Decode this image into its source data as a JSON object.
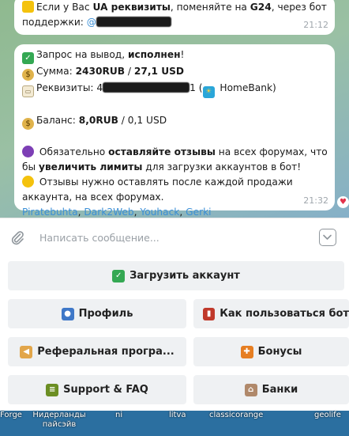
{
  "chat": {
    "message1": {
      "line1_pre": "Если у Вас ",
      "line1_bold": "UA реквизиты",
      "line1_mid": ", поменяйте на ",
      "line1_bold2": "G24",
      "line1_post": ", через бот",
      "line2_pre": "поддержки: ",
      "mention_prefix": "@",
      "time": "21:12"
    },
    "message2": {
      "l1_pre": "Запрос на вывод, ",
      "l1_bold": "исполнен",
      "l1_post": "!",
      "l2_pre": "Сумма: ",
      "l2_bold": "2430RUB",
      "l2_sep": " / ",
      "l2_bold2": "27,1 USD",
      "l3_pre": "Реквизиты: 4",
      "l3_mid": "1 (",
      "l3_post": " HomeBank)",
      "l4_pre": "Баланс: ",
      "l4_bold": "8,0RUB",
      "l4_post": " / 0,1 USD",
      "l5_pre": " Обязательно ",
      "l5_bold": "оставляйте отзывы",
      "l5_post": " на всех форумах, что",
      "l6_pre": "бы ",
      "l6_bold": "увеличить лимиты",
      "l6_post": " для загрузки аккаунтов в бот!",
      "l7": " Отзывы нужно оставлять после каждой продажи",
      "l8": "аккаунта, на всех форумах.",
      "links": [
        "Piratebuhta",
        "Dark2Web",
        "Youhack",
        "Gerki"
      ],
      "time": "21:32"
    }
  },
  "input": {
    "placeholder": "Написать сообщение..."
  },
  "keyboard": {
    "upload": "Загрузить аккаунт",
    "profile": "Профиль",
    "howto": "Как пользоваться бот",
    "referral": "Реферальная програ...",
    "bonuses": "Бонусы",
    "support": "Support & FAQ",
    "banks": "Банки"
  },
  "taskbar": {
    "items": [
      "Forge",
      "Нидерланды пайсэйв",
      "ni",
      "litva",
      "classicorange",
      "geolife"
    ]
  },
  "icons": {
    "attach": "paperclip-icon",
    "keyboard_toggle": "chevron-down-icon",
    "reaction": "heart-icon"
  },
  "colors": {
    "link": "#3b8fd6",
    "bubble": "#ffffff",
    "button_bg": "#eff1f3"
  }
}
